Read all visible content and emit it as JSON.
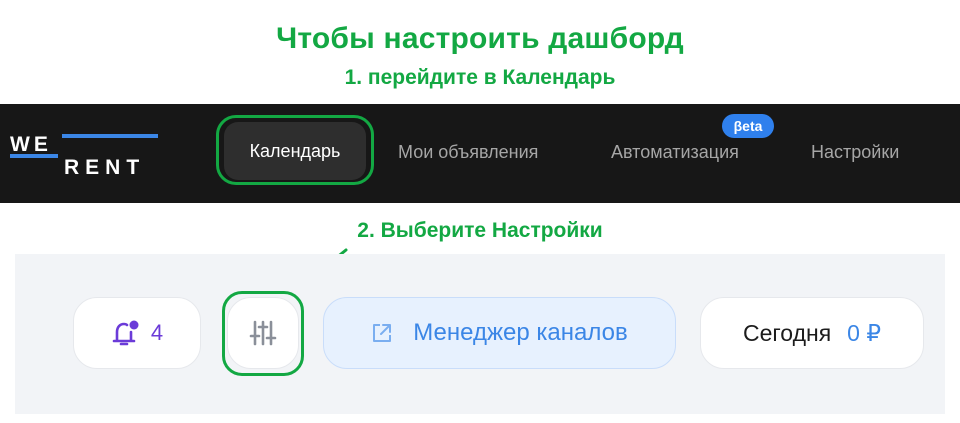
{
  "instructions": {
    "title": "Чтобы настроить дашборд",
    "step1": "1. перейдите в Календарь",
    "step2": "2. Выберите Настройки"
  },
  "brand": {
    "logo_top": "WE",
    "logo_bottom": "RENT",
    "logo_color": "#ffffff",
    "logo_accent": "#3b86e6"
  },
  "nav": {
    "items": [
      {
        "label": "Календарь",
        "active": true
      },
      {
        "label": "Мои объявления",
        "active": false
      },
      {
        "label": "Автоматизация",
        "active": false,
        "badge": "βeta"
      },
      {
        "label": "Настройки",
        "active": false
      }
    ]
  },
  "toolbar": {
    "notifications": {
      "icon": "bell-icon",
      "count": "4"
    },
    "settings": {
      "icon": "sliders-icon"
    },
    "channel_manager": {
      "icon": "external-link-icon",
      "label": "Менеджер каналов"
    },
    "today": {
      "label": "Сегодня",
      "amount": "0 ₽"
    }
  },
  "colors": {
    "highlight": "#13a843",
    "navbar_bg": "#171717",
    "accent_blue": "#3b86e6",
    "bell_purple": "#6b3bd8"
  }
}
